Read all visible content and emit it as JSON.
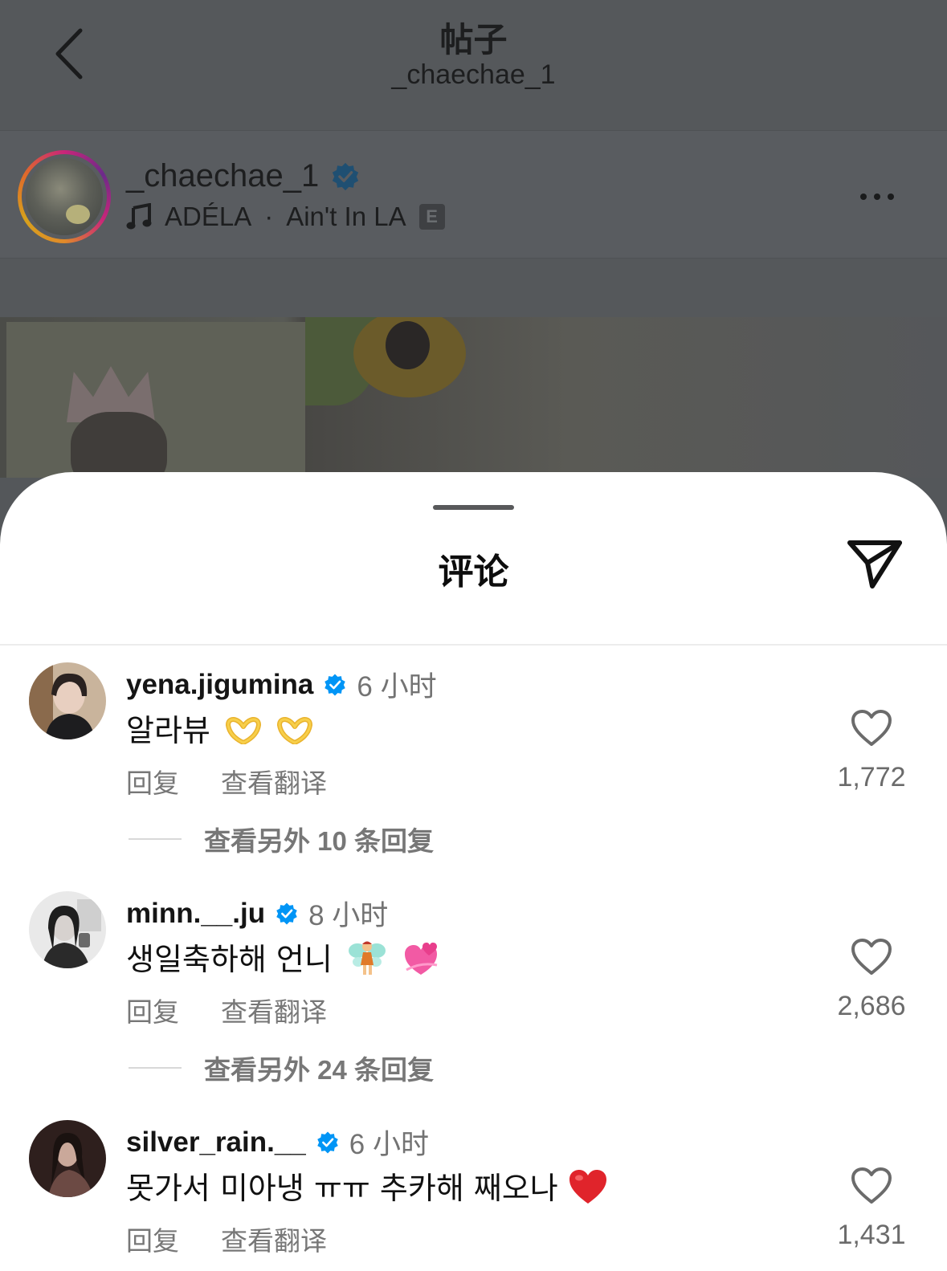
{
  "header": {
    "title": "帖子",
    "subtitle": "_chaechae_1"
  },
  "post": {
    "author": "_chaechae_1",
    "music_artist": "ADÉLA",
    "music_separator": "·",
    "music_title": "Ain't In LA",
    "explicit_badge": "E"
  },
  "sheet": {
    "title": "评论"
  },
  "comments": [
    {
      "username": "yena.jigumina",
      "time": "6 小时",
      "text": "알라뷰",
      "emoji": [
        "heart-hands-emoji",
        "heart-hands-emoji"
      ],
      "reply_label": "回复",
      "translate_label": "查看翻译",
      "likes": "1,772",
      "view_replies": "查看另外 10 条回复"
    },
    {
      "username": "minn.__.ju",
      "time": "8 小时",
      "text": "생일축하해 언니",
      "emoji": [
        "fairy-emoji",
        "revolving-hearts-emoji"
      ],
      "reply_label": "回复",
      "translate_label": "查看翻译",
      "likes": "2,686",
      "view_replies": "查看另外 24 条回复"
    },
    {
      "username": "silver_rain.__",
      "time": "6 小时",
      "text": "못가서 미아냉 ㅠㅠ 추카해 째오나",
      "emoji": [
        "red-heart-emoji"
      ],
      "reply_label": "回复",
      "translate_label": "查看翻译",
      "likes": "1,431"
    }
  ],
  "colors": {
    "verified": "#0095f6",
    "overlay_dim": "#55585b",
    "secondary_text": "#737373"
  },
  "icons": [
    "back-chevron-icon",
    "verified-badge-icon",
    "music-note-icon",
    "more-icon",
    "share-icon",
    "heart-icon"
  ]
}
